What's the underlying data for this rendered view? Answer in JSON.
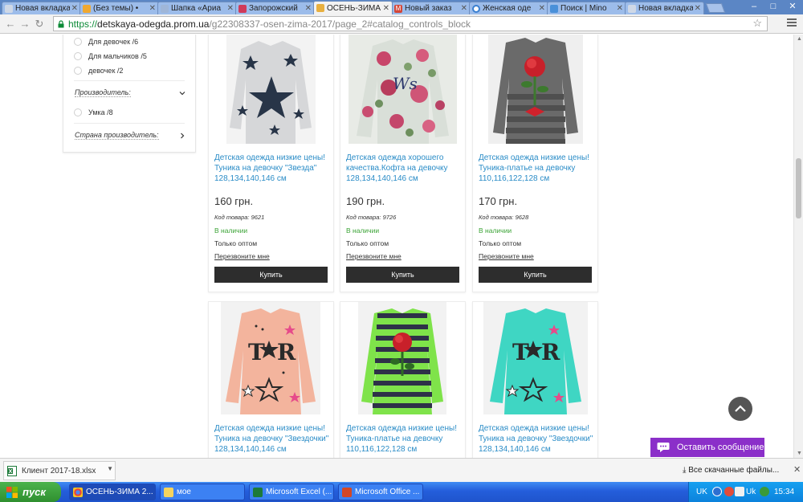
{
  "tabs": [
    {
      "label": "Новая вкладка",
      "icon": "page-icon",
      "color": "#cfd8e6"
    },
    {
      "label": "(Без темы) •",
      "icon": "mail-icon",
      "color": "#f0a830"
    },
    {
      "label": "Шапка «Ариа",
      "icon": "page-icon",
      "color": "#cfd8e6"
    },
    {
      "label": "Запорожский",
      "icon": "lips-icon",
      "color": "#d03a5a"
    },
    {
      "label": "ОСЕНЬ-ЗИМА",
      "icon": "shop-icon",
      "color": "#e8b040",
      "active": true
    },
    {
      "label": "Новый заказ",
      "icon": "gmail-icon",
      "color": "#d44638"
    },
    {
      "label": "Женская оде",
      "icon": "loading-icon",
      "color": "#3a7fd0"
    },
    {
      "label": "Поиск | Mino",
      "icon": "search-icon",
      "color": "#4a90d9"
    },
    {
      "label": "Новая вкладка",
      "icon": "page-icon",
      "color": "#cfd8e6"
    }
  ],
  "address": {
    "scheme": "https://",
    "host": "detskaya-odegda.prom.ua",
    "path": "/g22308337-osen-zima-2017/page_2#catalog_controls_block"
  },
  "sidebar": {
    "filters": [
      {
        "label": "Для девочек",
        "count": "/6"
      },
      {
        "label": "Для мальчиков",
        "count": "/5"
      },
      {
        "label": "девочек",
        "count": "/2"
      }
    ],
    "manufacturer_heading": "Производитель:",
    "manufacturers": [
      {
        "label": "Умка",
        "count": "/8"
      }
    ],
    "country_heading": "Страна производитель:"
  },
  "products": [
    {
      "name": "Детская одежда низкие цены! Туника на девочку \"Звезда\" 128,134,140,146 см",
      "price": "160 грн.",
      "code": "Код товара: 9621",
      "availability": "В наличии",
      "wholesale": "Только оптом",
      "call": "Перезвоните мне",
      "buy": "Купить",
      "image": "grey-star-tunic"
    },
    {
      "name": "Детская одежда хорошего качества.Кофта на девочку 128,134,140,146 см",
      "price": "190 грн.",
      "code": "Код товара: 9726",
      "availability": "В наличии",
      "wholesale": "Только оптом",
      "call": "Перезвоните мне",
      "buy": "Купить",
      "image": "floral-sweater"
    },
    {
      "name": "Детская одежда низкие цены! Туника-платье на девочку 110,116,122,128 см",
      "price": "170 грн.",
      "code": "Код товара: 9628",
      "availability": "В наличии",
      "wholesale": "Только оптом",
      "call": "Перезвоните мне",
      "buy": "Купить",
      "image": "striped-rose-dress"
    },
    {
      "name": "Детская одежда низкие цены! Туника на девочку \"Звездочки\" 128,134,140,146 см",
      "image": "peach-star-tunic"
    },
    {
      "name": "Детская одежда низкие цены! Туника-платье на девочку 110,116,122,128 см",
      "image": "green-striped-rose-dress"
    },
    {
      "name": "Детская одежда низкие цены! Туника на девочку \"Звездочки\" 128,134,140,146 см",
      "image": "mint-star-tunic"
    }
  ],
  "widgets": {
    "message_button": "Оставить сообщение"
  },
  "downloads": {
    "file": "Клиент 2017-18.xlsx",
    "all_link": "Все скачанные файлы..."
  },
  "taskbar": {
    "start": "пуск",
    "tasks": [
      {
        "label": "ОСЕНЬ-ЗИМА 2...",
        "icon": "chrome-icon"
      },
      {
        "label": "мое",
        "icon": "folder-icon"
      },
      {
        "label": "Microsoft Excel (...",
        "icon": "excel-icon"
      },
      {
        "label": "Microsoft Office ...",
        "icon": "office-icon"
      }
    ],
    "lang": "UK",
    "lang2": "Uk",
    "time": "15:34"
  },
  "colors": {
    "link": "#2a8cc7",
    "in_stock": "#3aa335",
    "buy_button": "#2d2d2d",
    "message_button": "#8b2fc9"
  }
}
